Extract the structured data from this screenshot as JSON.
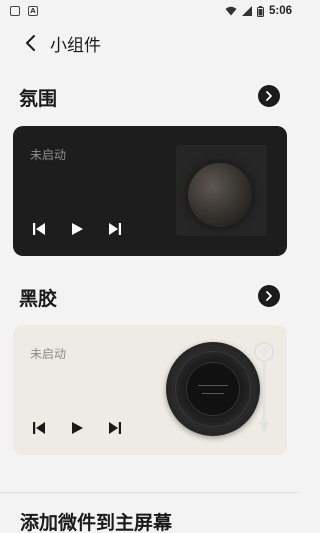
{
  "status_bar": {
    "time": "5:06",
    "left_icons": [
      "notification-icon",
      "app-icon"
    ]
  },
  "header": {
    "title": "小组件"
  },
  "sections": [
    {
      "title": "氛围",
      "card": {
        "status": "未启动",
        "theme": "dark"
      }
    },
    {
      "title": "黑胶",
      "card": {
        "status": "未启动",
        "theme": "light"
      }
    }
  ],
  "footer": {
    "title": "添加微件到主屏幕"
  },
  "colors": {
    "background": "#f3f3f3",
    "dark_card": "#1d1d1d",
    "light_card": "#eeebe5",
    "accent": "#1c1c1c"
  }
}
